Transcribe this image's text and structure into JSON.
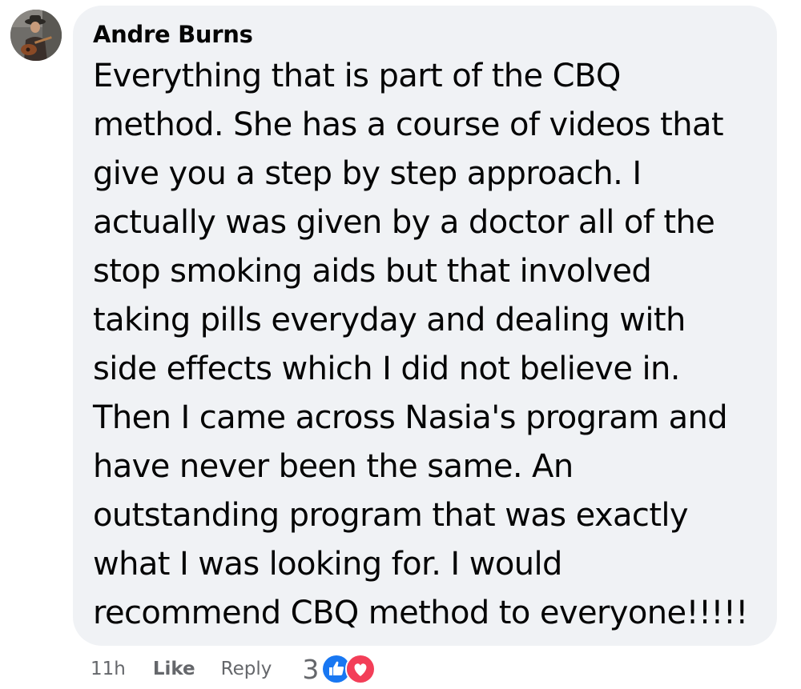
{
  "comment": {
    "author": "Andre Burns",
    "avatar_icon": "user-avatar-guitar",
    "lines": [
      "Everything that is part of the CBQ",
      "method. She has a course of videos that",
      "give you a step by step approach. I",
      "actually was given by a doctor all of the",
      "stop smoking aids but that involved",
      "taking pills everyday and dealing with",
      "side effects which I did not believe in.",
      "Then I came across Nasia's program and",
      "have never been the same. An",
      "outstanding program that was exactly",
      "what I was looking for. I would",
      "recommend CBQ method to everyone!!!!!"
    ]
  },
  "actions": {
    "time": "11h",
    "like_label": "Like",
    "reply_label": "Reply",
    "reaction_count": "3",
    "reaction_icons": [
      "like-reaction-icon",
      "love-reaction-icon"
    ]
  },
  "colors": {
    "bubble": "#f0f2f5",
    "text": "#050505",
    "meta": "#65676b",
    "like_blue": "#1877f2",
    "love_red": "#f33e58"
  }
}
